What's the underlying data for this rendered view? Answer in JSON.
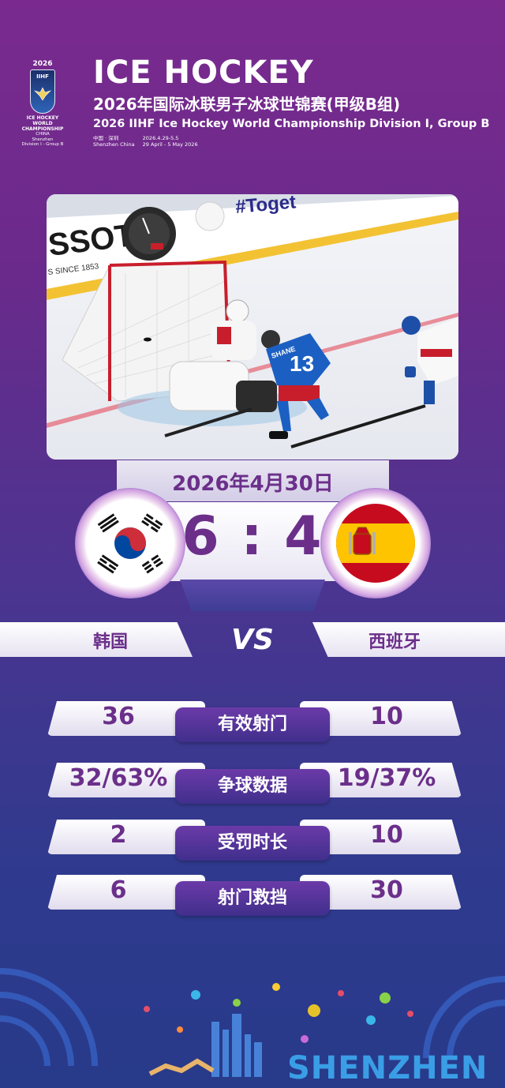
{
  "header": {
    "logo_year": "2026",
    "logo_org": "IIHF",
    "logo_lines": [
      "ICE HOCKEY",
      "WORLD",
      "CHAMPIONSHIP"
    ],
    "logo_country": "CHINA",
    "logo_city": "Shenzhen",
    "logo_division": "Division I - Group B",
    "title": "ICE HOCKEY",
    "subtitle_cn": "2026年国际冰联男子冰球世锦赛(甲级B组)",
    "subtitle_en": "2026 IIHF Ice Hockey World Championship Division I, Group B",
    "location_cn": "中国 · 深圳",
    "location_en": "Shenzhen China",
    "dates": "2026.4.29-5.5",
    "dates_en": "29 April - 5 May 2026"
  },
  "photo": {
    "ad_left": "SSOT",
    "ad_since": "S SINCE 1853",
    "ad_slogan": "#Toget",
    "jersey_number": "13",
    "jersey_name": "SHANE"
  },
  "match": {
    "date": "2026年4月30日",
    "score": "6 : 4",
    "home_team": "韩国",
    "away_team": "西班牙",
    "vs": "VS"
  },
  "stats": [
    {
      "label": "有效射门",
      "home": "36",
      "away": "10"
    },
    {
      "label": "争球数据",
      "home": "32/63%",
      "away": "19/37%"
    },
    {
      "label": "受罚时长",
      "home": "2",
      "away": "10"
    },
    {
      "label": "射门救挡",
      "home": "6",
      "away": "30"
    }
  ],
  "footer": {
    "city_mark": "SHENZHEN"
  },
  "colors": {
    "accent_purple": "#6b2f8a",
    "bg_top": "#7a2a8e",
    "bg_bottom": "#283a8a",
    "shenzhen_blue": "#3a9ee6"
  }
}
